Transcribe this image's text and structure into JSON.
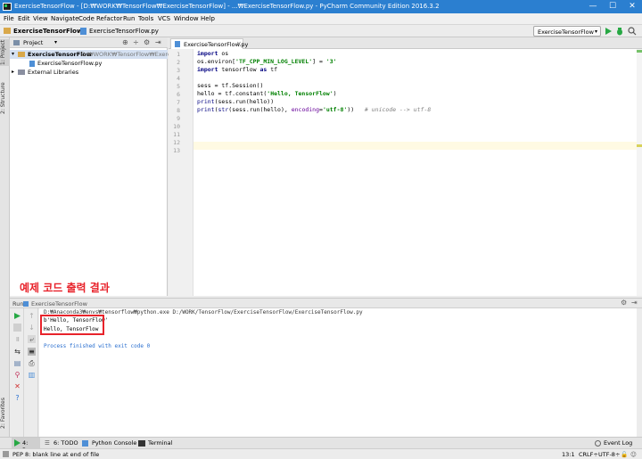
{
  "window": {
    "title": "ExerciseTensorFlow - [D:₩WORK₩TensorFlow₩ExerciseTensorFlow] - ...₩ExerciseTensorFlow.py - PyCharm Community Edition 2016.3.2",
    "minimize": "—",
    "maximize": "☐",
    "close": "✕"
  },
  "menu": [
    "File",
    "Edit",
    "View",
    "Navigate",
    "Code",
    "Refactor",
    "Run",
    "Tools",
    "VCS",
    "Window",
    "Help"
  ],
  "nav": {
    "project": "ExerciseTensorFlow",
    "file": "ExerciseTensorFlow.py",
    "run_config": "ExerciseTensorFlow"
  },
  "side_tabs": {
    "project": "1: Project",
    "structure": "2: Structure",
    "favorites": "2: Favorites"
  },
  "project_panel": {
    "header": "Project",
    "root_name": "ExerciseTensorFlow",
    "root_path": "D:₩WORK₩TensorFlow₩ExerciseT",
    "file": "ExerciseTensorFlow.py",
    "libraries": "External Libraries"
  },
  "editor": {
    "tab": "ExerciseTensorFlow.py",
    "line_numbers": [
      "1",
      "2",
      "3",
      "4",
      "5",
      "6",
      "7",
      "8",
      "9",
      "10",
      "11",
      "12",
      "13"
    ]
  },
  "caption": "예제 코드 출력 결과",
  "run_panel": {
    "label": "Run",
    "config": "ExerciseTensorFlow",
    "command": "D:₩Anaconda3₩envs₩tensorflow₩python.exe D:/WORK/TensorFlow/ExerciseTensorFlow/ExerciseTensorFlow.py",
    "output1": "b'Hello, TensorFlow'",
    "output2": "Hello, TensorFlow",
    "finished": "Process finished with exit code 0"
  },
  "bottom_tabs": {
    "run": "4: Run",
    "todo": "6: TODO",
    "console": "Python Console",
    "terminal": "Terminal",
    "event_log": "Event Log"
  },
  "status": {
    "message": "PEP 8: blank line at end of file",
    "position": "13:1",
    "line_sep": "CRLF÷",
    "encoding": "UTF-8÷"
  },
  "colors": {
    "titlebar": "#2b7fd0",
    "highlight": "#e8232b",
    "run_green": "#27a844"
  }
}
